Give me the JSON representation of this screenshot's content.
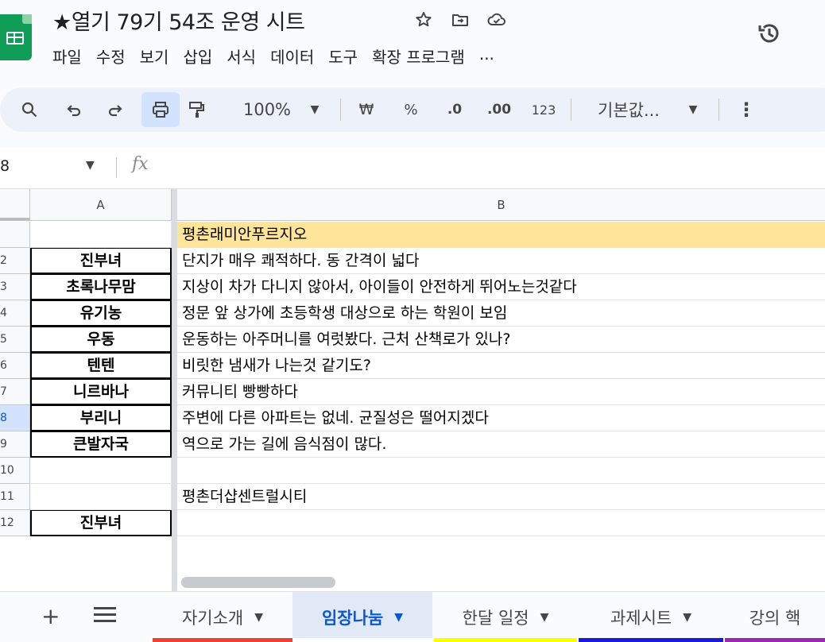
{
  "header": {
    "doc_title": "★열기 79기 54조 운영 시트",
    "menu": [
      "파일",
      "수정",
      "보기",
      "삽입",
      "서식",
      "데이터",
      "도구",
      "확장 프로그램",
      "..."
    ]
  },
  "toolbar": {
    "zoom": "100%",
    "currency": "₩",
    "percent": "%",
    "decrease_decimal": ".0",
    "increase_decimal": ".00",
    "number_format": "123",
    "font": "기본값..."
  },
  "formula_bar": {
    "name_box": "8",
    "fx": "fx"
  },
  "grid": {
    "columns": [
      "A",
      "B"
    ],
    "rows": [
      {
        "num": "",
        "a": "",
        "b": "평촌래미안푸르지오",
        "highlight": true,
        "boxed": false,
        "selected": false
      },
      {
        "num": "2",
        "a": "진부녀",
        "b": "단지가 매우 쾌적하다. 동 간격이 넓다",
        "highlight": false,
        "boxed": true,
        "selected": false
      },
      {
        "num": "3",
        "a": "초록나무맘",
        "b": "지상이 차가 다니지 않아서, 아이들이 안전하게 뛰어노는것같다",
        "highlight": false,
        "boxed": true,
        "selected": false
      },
      {
        "num": "4",
        "a": "유기농",
        "b": "정문 앞 상가에 초등학생 대상으로 하는 학원이 보임",
        "highlight": false,
        "boxed": true,
        "selected": false
      },
      {
        "num": "5",
        "a": "우동",
        "b": "운동하는 아주머니를 여럿봤다. 근처 산책로가 있나?",
        "highlight": false,
        "boxed": true,
        "selected": false
      },
      {
        "num": "6",
        "a": "텐텐",
        "b": "비릿한 냄새가 나는것 같기도?",
        "highlight": false,
        "boxed": true,
        "selected": false
      },
      {
        "num": "7",
        "a": "니르바나",
        "b": "커뮤니티 빵빵하다",
        "highlight": false,
        "boxed": true,
        "selected": false
      },
      {
        "num": "8",
        "a": "부리니",
        "b": "주변에 다른 아파트는 없네. 균질성은 떨어지겠다",
        "highlight": false,
        "boxed": true,
        "selected": true
      },
      {
        "num": "9",
        "a": "큰발자국",
        "b": "역으로 가는 길에 음식점이 많다.",
        "highlight": false,
        "boxed": true,
        "selected": false
      },
      {
        "num": "10",
        "a": "",
        "b": "",
        "highlight": false,
        "boxed": false,
        "selected": false
      },
      {
        "num": "11",
        "a": "",
        "b": "평촌더샵센트럴시티",
        "highlight": false,
        "boxed": false,
        "selected": false
      },
      {
        "num": "12",
        "a": "진부녀",
        "b": "",
        "highlight": false,
        "boxed": true,
        "selected": false
      }
    ]
  },
  "sheet_tabs": [
    {
      "label": "자기소개",
      "color": "#ea4335",
      "active": false
    },
    {
      "label": "임장나눔",
      "color": "#ffffff",
      "active": true
    },
    {
      "label": "한달 일정",
      "color": "#ffff00",
      "active": false
    },
    {
      "label": "과제시트",
      "color": "#1a1ad6",
      "active": false
    },
    {
      "label": "강의 핵",
      "color": "#9c27b0",
      "active": false
    }
  ],
  "colors": {
    "highlight_row": "#ffe599",
    "selection": "#d3e3fd",
    "accent": "#0b57d0",
    "sheets_green": "#0f9d58"
  }
}
